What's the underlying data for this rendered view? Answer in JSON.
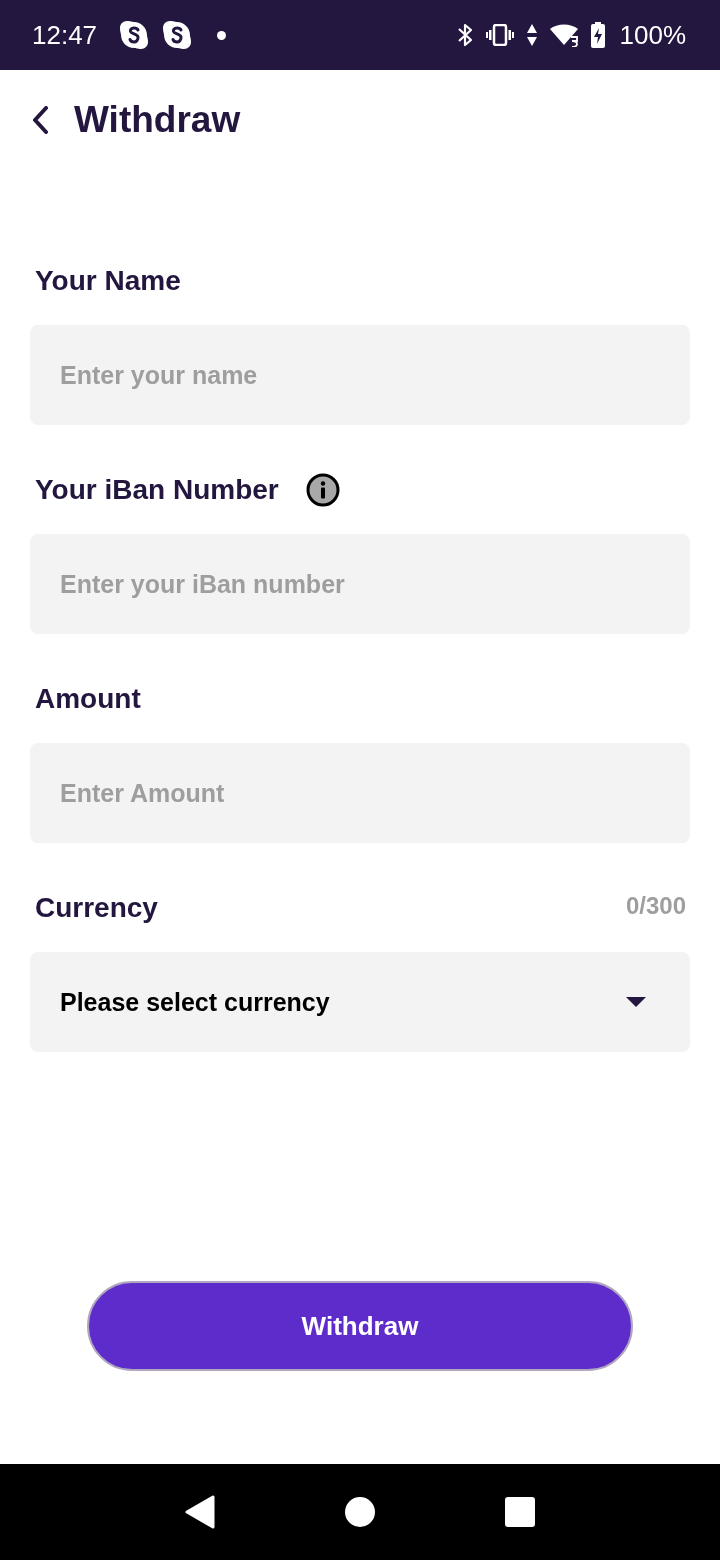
{
  "status_bar": {
    "time": "12:47",
    "battery": "100%"
  },
  "header": {
    "title": "Withdraw"
  },
  "form": {
    "fields": [
      {
        "kind": "text",
        "label": "Your Name",
        "info": false,
        "placeholder": "Enter your name"
      },
      {
        "kind": "text",
        "label": "Your iBan Number",
        "info": true,
        "placeholder": "Enter your iBan number"
      },
      {
        "kind": "text",
        "label": "Amount",
        "info": false,
        "placeholder": "Enter Amount"
      },
      {
        "kind": "select",
        "label": "Currency",
        "info": false,
        "counter": "0/300",
        "value": "Please select currency"
      }
    ]
  },
  "submit_button": {
    "label": "Withdraw"
  }
}
